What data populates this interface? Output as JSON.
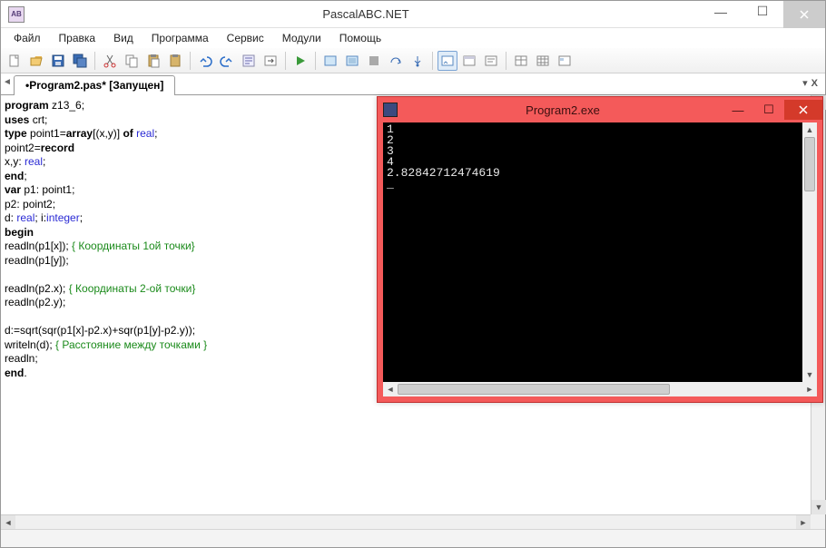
{
  "window": {
    "title": "PascalABC.NET",
    "app_icon_text": "AB"
  },
  "menu": {
    "items": [
      "Файл",
      "Правка",
      "Вид",
      "Программа",
      "Сервис",
      "Модули",
      "Помощь"
    ]
  },
  "tabs": {
    "active": "•Program2.pas* [Запущен]"
  },
  "code": {
    "lines": [
      {
        "t": [
          {
            "c": "kw",
            "s": "program"
          },
          {
            "s": " z13_6;"
          }
        ]
      },
      {
        "t": [
          {
            "c": "kw",
            "s": "uses"
          },
          {
            "s": " crt;"
          }
        ]
      },
      {
        "t": [
          {
            "c": "kw",
            "s": "type"
          },
          {
            "s": " point1="
          },
          {
            "c": "kw",
            "s": "array"
          },
          {
            "s": "[(x,y)] "
          },
          {
            "c": "kw",
            "s": "of"
          },
          {
            "s": " "
          },
          {
            "c": "tp",
            "s": "real"
          },
          {
            "s": ";"
          }
        ]
      },
      {
        "t": [
          {
            "s": "point2="
          },
          {
            "c": "kw",
            "s": "record"
          }
        ]
      },
      {
        "t": [
          {
            "s": "x,y: "
          },
          {
            "c": "tp",
            "s": "real"
          },
          {
            "s": ";"
          }
        ]
      },
      {
        "t": [
          {
            "c": "kw",
            "s": "end"
          },
          {
            "s": ";"
          }
        ]
      },
      {
        "t": [
          {
            "c": "kw",
            "s": "var"
          },
          {
            "s": " p1: point1;"
          }
        ]
      },
      {
        "t": [
          {
            "s": "p2: point2;"
          }
        ]
      },
      {
        "t": [
          {
            "s": "d: "
          },
          {
            "c": "tp",
            "s": "real"
          },
          {
            "s": "; i:"
          },
          {
            "c": "tp",
            "s": "integer"
          },
          {
            "s": ";"
          }
        ]
      },
      {
        "t": [
          {
            "c": "kw",
            "s": "begin"
          }
        ]
      },
      {
        "t": [
          {
            "s": "readln(p1[x]); "
          },
          {
            "c": "cm",
            "s": "{ Координаты 1ой точки}"
          }
        ]
      },
      {
        "t": [
          {
            "s": "readln(p1[y]);"
          }
        ]
      },
      {
        "t": [
          {
            "s": " "
          }
        ]
      },
      {
        "t": [
          {
            "s": "readln(p2.x); "
          },
          {
            "c": "cm",
            "s": "{ Координаты 2-ой точки}"
          }
        ]
      },
      {
        "t": [
          {
            "s": "readln(p2.y);"
          }
        ]
      },
      {
        "t": [
          {
            "s": " "
          }
        ]
      },
      {
        "t": [
          {
            "s": "d:=sqrt(sqr(p1[x]-p2.x)+sqr(p1[y]-p2.y));"
          }
        ]
      },
      {
        "t": [
          {
            "s": "writeln(d); "
          },
          {
            "c": "cm",
            "s": "{ Расстояние между точками }"
          }
        ]
      },
      {
        "t": [
          {
            "s": "readln;"
          }
        ]
      },
      {
        "t": [
          {
            "c": "kw",
            "s": "end"
          },
          {
            "s": "."
          }
        ]
      }
    ]
  },
  "console": {
    "title": "Program2.exe",
    "output": "1\n2\n3\n4\n2.82842712474619\n_"
  },
  "toolbar_icons": [
    "new-file",
    "open-file",
    "save",
    "save-all",
    "sep",
    "cut",
    "copy",
    "paste",
    "paste-special",
    "sep",
    "undo",
    "redo",
    "find",
    "nav",
    "sep",
    "run",
    "sep",
    "compile",
    "run-noform",
    "stop",
    "step",
    "step-into",
    "sep",
    "panel-output",
    "panel-form",
    "panel-msg",
    "sep",
    "table",
    "table-form",
    "panel-extra"
  ]
}
